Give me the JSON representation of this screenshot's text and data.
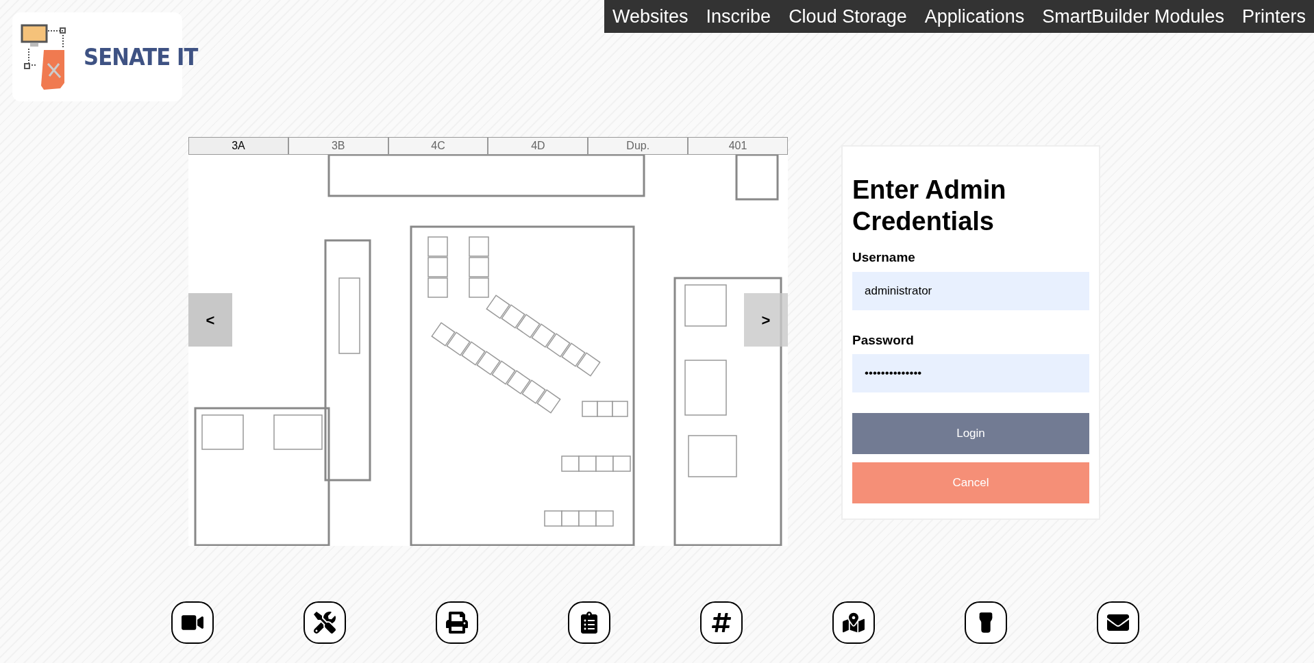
{
  "logo": {
    "text": "SENATE IT"
  },
  "nav": [
    "Websites",
    "Inscribe",
    "Cloud Storage",
    "Applications",
    "SmartBuilder Modules",
    "Printers"
  ],
  "floor_tabs": [
    {
      "label": "3A",
      "selected": true
    },
    {
      "label": "3B",
      "selected": false
    },
    {
      "label": "4C",
      "selected": false
    },
    {
      "label": "4D",
      "selected": false
    },
    {
      "label": "Dup.",
      "selected": false
    },
    {
      "label": "401",
      "selected": false
    }
  ],
  "carousel": {
    "prev": "<",
    "next": ">"
  },
  "login": {
    "title": "Enter Admin Credentials",
    "username_label": "Username",
    "username_value": "administrator",
    "password_label": "Password",
    "password_value": "••••••••••••••",
    "login_button": "Login",
    "cancel_button": "Cancel"
  },
  "shortcuts": [
    {
      "kind": "video"
    },
    {
      "kind": "tools"
    },
    {
      "kind": "printer"
    },
    {
      "kind": "clipboard"
    },
    {
      "kind": "hash"
    },
    {
      "kind": "map"
    },
    {
      "kind": "flashlight"
    },
    {
      "kind": "mail"
    }
  ]
}
